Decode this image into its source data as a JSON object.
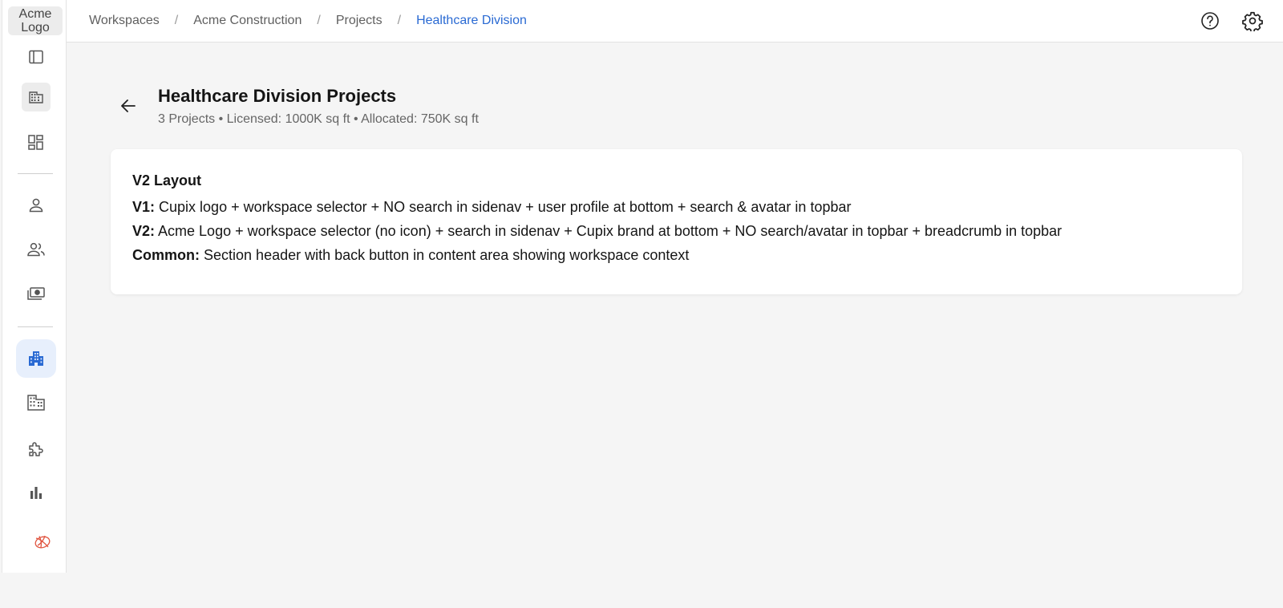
{
  "sidenav": {
    "logo_text": "Acme Logo",
    "items": [
      {
        "name": "sidebar-toggle-icon"
      },
      {
        "name": "building-icon"
      },
      {
        "name": "dashboard-icon"
      },
      {
        "name": "person-icon"
      },
      {
        "name": "people-icon"
      },
      {
        "name": "money-icon"
      },
      {
        "name": "apartment-icon",
        "active": true
      },
      {
        "name": "business-icon"
      },
      {
        "name": "extension-icon"
      },
      {
        "name": "bar-chart-icon"
      },
      {
        "name": "cupix-brand-icon"
      }
    ]
  },
  "topbar": {
    "breadcrumb": [
      "Workspaces",
      "Acme Construction",
      "Projects",
      "Healthcare Division"
    ],
    "separator": "/",
    "icons": [
      "help-icon",
      "settings-icon"
    ]
  },
  "header": {
    "title": "Healthcare Division Projects",
    "subtitle": "3 Projects • Licensed: 1000K sq ft • Allocated: 750K sq ft"
  },
  "card": {
    "title": "V2 Layout",
    "lines": [
      {
        "label": "V1:",
        "text": "Cupix logo + workspace selector + NO search in sidenav + user profile at bottom + search & avatar in topbar"
      },
      {
        "label": "V2:",
        "text": "Acme Logo + workspace selector (no icon) + search in sidenav + Cupix brand at bottom + NO search/avatar in topbar + breadcrumb in topbar"
      },
      {
        "label": "Common:",
        "text": "Section header with back button in content area showing workspace context"
      }
    ]
  },
  "colors": {
    "accent": "#2a6ad3",
    "active_bg": "#e7effc",
    "brand_red": "#e0533e"
  }
}
